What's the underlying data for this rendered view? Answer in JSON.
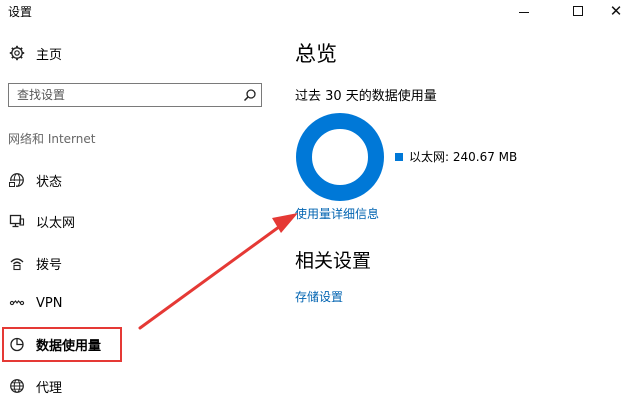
{
  "window": {
    "title": "设置",
    "minimize_icon": "minimize-icon",
    "maximize_icon": "maximize-icon",
    "close_icon": "close-icon",
    "close_glyph": "✕"
  },
  "sidebar": {
    "home": {
      "label": "主页",
      "icon": "gear-icon"
    },
    "search": {
      "placeholder": "查找设置",
      "icon": "search-icon"
    },
    "section_header": "网络和 Internet",
    "items": [
      {
        "label": "状态",
        "icon": "globe-status-icon"
      },
      {
        "label": "以太网",
        "icon": "monitor-icon"
      },
      {
        "label": "拨号",
        "icon": "dialup-icon"
      },
      {
        "label": "VPN",
        "icon": "vpn-icon"
      },
      {
        "label": "数据使用量",
        "icon": "pie-chart-icon",
        "selected": true
      },
      {
        "label": "代理",
        "icon": "globe-icon"
      }
    ]
  },
  "main": {
    "title": "总览",
    "subtitle": "过去 30 天的数据使用量",
    "legend_label": "以太网: 240.67 MB",
    "details_link": "使用量详细信息",
    "related_title": "相关设置",
    "storage_link": "存储设置"
  },
  "colors": {
    "accent": "#0078d7",
    "link": "#0063b1",
    "highlight": "#e53935"
  },
  "chart_data": {
    "type": "pie",
    "categories": [
      "以太网"
    ],
    "values": [
      240.67
    ],
    "unit": "MB"
  }
}
